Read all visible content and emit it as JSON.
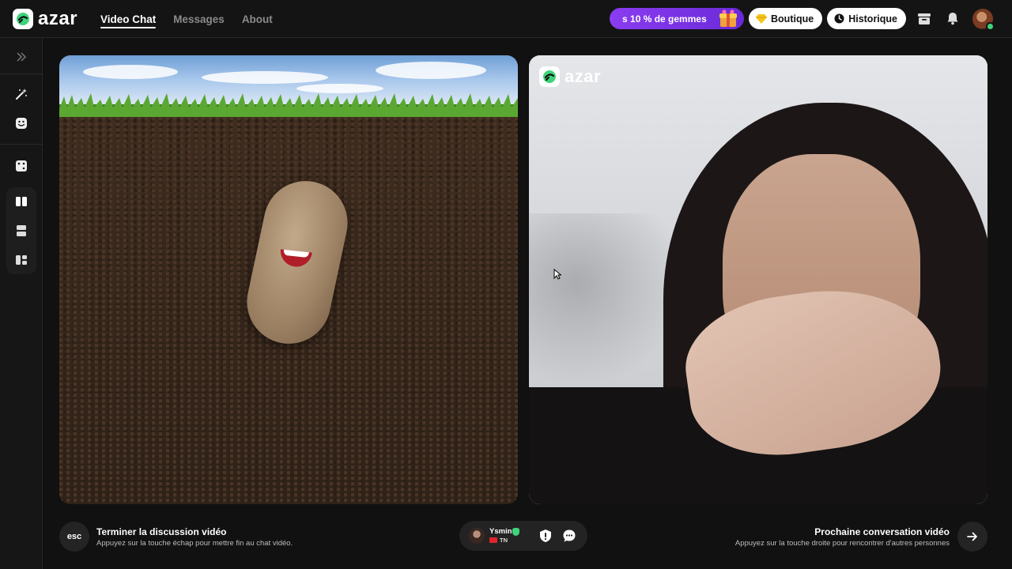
{
  "app": {
    "name": "azar"
  },
  "nav": {
    "items": [
      {
        "label": "Video Chat",
        "active": true
      },
      {
        "label": "Messages",
        "active": false
      },
      {
        "label": "About",
        "active": false
      }
    ]
  },
  "header": {
    "promo_label": "s 10 % de gemmes",
    "shop_label": "Boutique",
    "history_label": "Historique"
  },
  "sidebar": {
    "icons": [
      "expand-icon",
      "magic-wand-icon",
      "emoji-icon",
      "dice-icon",
      "layout-side-by-side-icon",
      "layout-stacked-icon",
      "layout-grid-icon"
    ]
  },
  "video": {
    "remote_logo": "azar"
  },
  "bottom": {
    "esc_key": "esc",
    "end_title": "Terminer la discussion vidéo",
    "end_subtitle": "Appuyez sur la touche échap pour mettre fin au chat vidéo.",
    "peer_name": "Ysmin",
    "peer_country": "TN",
    "next_title": "Prochaine conversation vidéo",
    "next_subtitle": "Appuyez sur la touche droite pour rencontrer d'autres personnes"
  },
  "colors": {
    "accent": "#3fd37a",
    "promo": "#7b33e6",
    "background": "#111111"
  }
}
